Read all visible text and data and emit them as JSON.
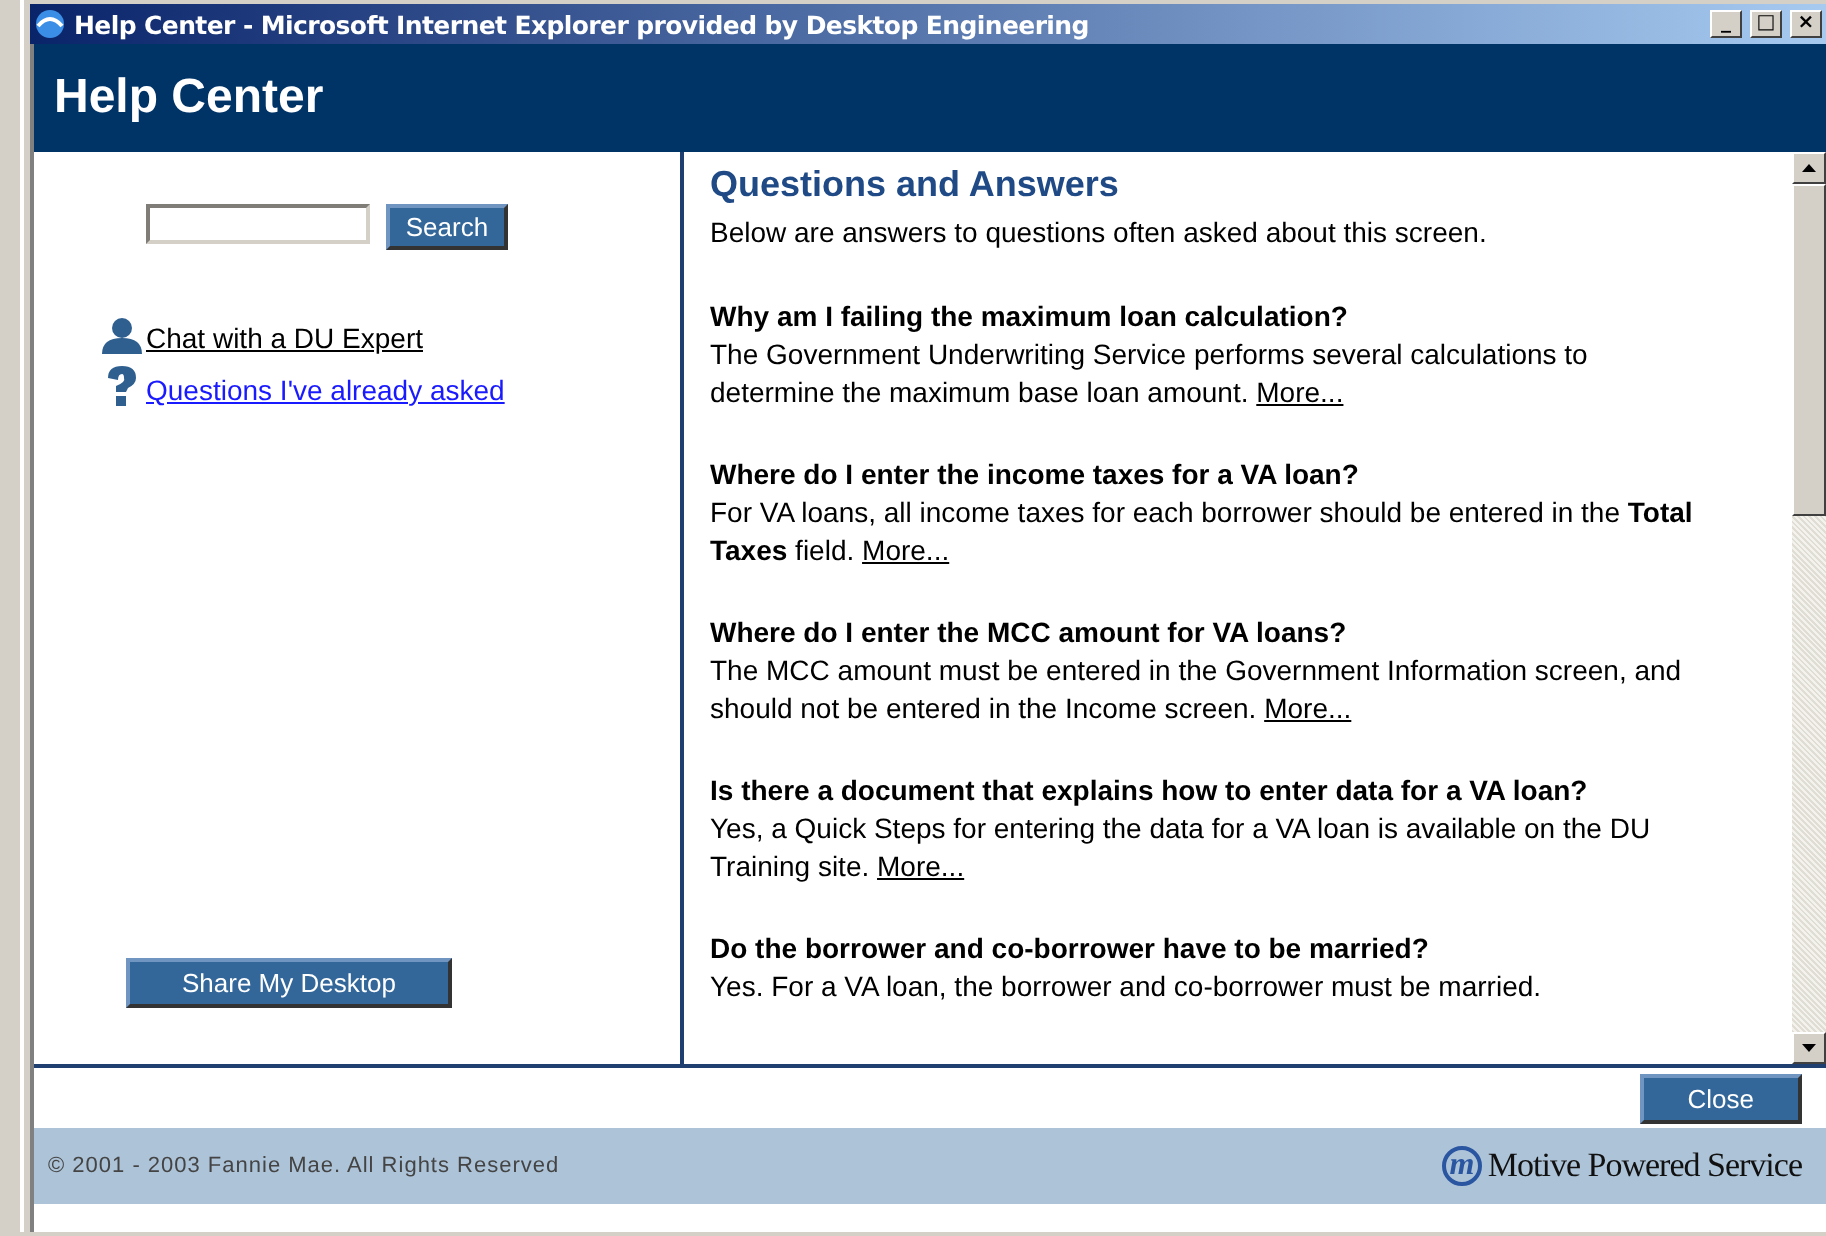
{
  "window": {
    "title": "Help Center - Microsoft Internet Explorer provided by Desktop Engineering",
    "controls": [
      "_",
      "□",
      "×"
    ]
  },
  "header": {
    "title": "Help Center"
  },
  "sidebar": {
    "search": {
      "button": "Search"
    },
    "links": [
      {
        "label": "Chat with a DU Expert",
        "kind": "person"
      },
      {
        "label": "Questions I've already asked",
        "kind": "question"
      }
    ],
    "share_button": "Share My Desktop"
  },
  "content": {
    "title": "Questions and Answers",
    "intro": "Below are answers to questions often asked about this screen.",
    "items": [
      {
        "question": "Why am I failing the maximum loan calculation?",
        "answer": "The Government Underwriting Service performs several calculations to determine the maximum base loan amount.",
        "more": "More..."
      },
      {
        "question": "Where do I enter the income taxes for a VA loan?",
        "answer": "For VA loans, all income taxes for each borrower should be entered in the **Total Taxes** field.",
        "more": "More..."
      },
      {
        "question": "Where do I enter the MCC amount for VA loans?",
        "answer": "The MCC amount must be entered in the Government Information screen, and should not be entered in the Income screen.",
        "more": "More..."
      },
      {
        "question": "Is there a document that explains how to enter data for a VA loan?",
        "answer": "Yes, a Quick Steps for entering the data for a VA loan is available on the DU Training site.",
        "more": "More..."
      },
      {
        "question": "Do the borrower and co-borrower have to be married?",
        "answer": "Yes. For a VA loan, the borrower and co-borrower must be married."
      }
    ]
  },
  "close_button": "Close",
  "footer": {
    "copyright": "© 2001 - 2003 Fannie Mae. All Rights Reserved",
    "logo_mark": "m",
    "logo_text": "Motive Powered Service"
  }
}
